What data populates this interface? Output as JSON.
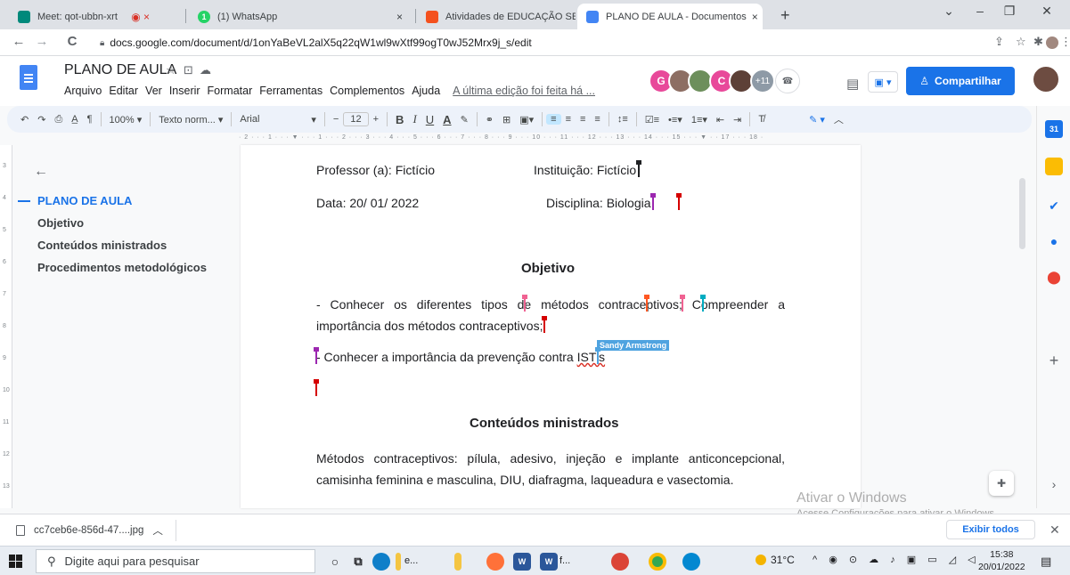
{
  "browser": {
    "tabs": [
      {
        "label": "Meet: qot-ubbn-xrt",
        "favicon_color": "#00897b",
        "extra": "◉ ×"
      },
      {
        "label": "(1) WhatsApp",
        "favicon_color": "#25d366",
        "favicon_text": "1"
      },
      {
        "label": "Atividades de EDUCAÇÃO SEXUA",
        "favicon_color": "#f4511e"
      },
      {
        "label": "PLANO DE AULA - Documentos",
        "favicon_color": "#4285f4",
        "active": true
      }
    ],
    "url": "docs.google.com/document/d/1onYaBeVL2alX5q22qW1wl9wXtf99ogT0wJ52Mrx9j_s/edit"
  },
  "docs": {
    "title": "PLANO DE AULA",
    "menu": [
      "Arquivo",
      "Editar",
      "Ver",
      "Inserir",
      "Formatar",
      "Ferramentas",
      "Complementos",
      "Ajuda"
    ],
    "last_edit": "A última edição foi feita há ...",
    "collaborators": [
      {
        "initial": "G",
        "color": "#e8499a"
      },
      {
        "initial": "",
        "color": "#8d6e63"
      },
      {
        "initial": "",
        "color": "#6d8f5c"
      },
      {
        "initial": "C",
        "color": "#e8499a"
      },
      {
        "initial": "",
        "color": "#5d4037"
      }
    ],
    "collaborators_more": "+11",
    "share_label": "Compartilhar"
  },
  "toolbar": {
    "zoom": "100%",
    "style": "Texto norm...",
    "font": "Arial",
    "font_size": "12"
  },
  "outline": {
    "items": [
      {
        "label": "PLANO DE AULA",
        "active": true
      },
      {
        "label": "Objetivo"
      },
      {
        "label": "Conteúdos ministrados"
      },
      {
        "label": "Procedimentos metodológicos"
      }
    ]
  },
  "document": {
    "professor": "Professor (a): Fictício",
    "instituicao": "Instituição: Fictício",
    "data": "Data: 20/ 01/ 2022",
    "disciplina": "Disciplina: Biologia",
    "heading_objetivo": "Objetivo",
    "objetivo_line1": "- Conhecer os diferentes tipos de métodos contraceptivos; Compreender a",
    "objetivo_line2": "importância dos métodos contraceptivos;",
    "objetivo_ist_prefix": "- Conhecer a importância da prevenção contra ",
    "objetivo_ist_word": "IST's",
    "cursor_user": "Sandy Armstrong",
    "heading_conteudos": "Conteúdos ministrados",
    "conteudos_line1": "Métodos contraceptivos: pílula, adesivo, injeção e implante anticoncepcional,",
    "conteudos_line2": "camisinha feminina e masculina, DIU, diafragma, laqueadura e vasectomia."
  },
  "windows": {
    "watermark_title": "Ativar o Windows",
    "watermark_text": "Acesse Configurações para ativar o Windows.",
    "search_placeholder": "Digite aqui para pesquisar",
    "weather": "31°C",
    "time": "15:38",
    "date": "20/01/2022",
    "taskbar_edge_label": "e...",
    "taskbar_word_label": "f..."
  },
  "download": {
    "filename": "cc7ceb6e-856d-47....jpg",
    "show_all": "Exibir todos"
  },
  "colors": {
    "accent": "#1a73e8",
    "cursor_red": "#d50000",
    "cursor_purple": "#9c27b0",
    "cursor_pink": "#f06292",
    "cursor_teal": "#00acc1",
    "cursor_orange": "#ff5722"
  }
}
